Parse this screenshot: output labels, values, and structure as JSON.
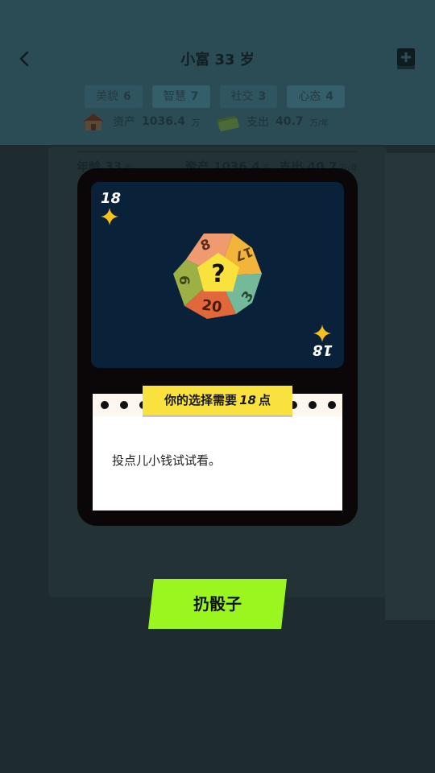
{
  "header": {
    "title": "小富 33 岁"
  },
  "stats": [
    {
      "label": "美貌",
      "value": "6"
    },
    {
      "label": "智慧",
      "value": "7"
    },
    {
      "label": "社交",
      "value": "3"
    },
    {
      "label": "心态",
      "value": "4"
    }
  ],
  "money": {
    "assets_label": "资产",
    "assets_value": "1036.4",
    "assets_unit": "万",
    "expense_label": "支出",
    "expense_value": "40.7",
    "expense_unit": "万/年"
  },
  "summary": {
    "age_label": "年龄",
    "age_value": "33",
    "age_unit": "岁",
    "assets_label": "资产",
    "assets_value": "1036.4",
    "assets_unit": "万",
    "expense_label": "支出",
    "expense_value": "40.7",
    "expense_unit": "万/年"
  },
  "dice_card": {
    "corner_top": "18",
    "corner_bottom": "18",
    "face_center": "?",
    "face_top": "8",
    "face_right_top": "17",
    "face_left": "6",
    "face_right": "3",
    "face_bottom": "20",
    "sparkle_color": "#f4c21a"
  },
  "choice": {
    "prefix": "你的选择需要",
    "points": "18",
    "suffix": "点"
  },
  "note": {
    "text": "投点儿小钱试试看。"
  },
  "roll_button": {
    "label": "扔骰子",
    "color": "#9bf51e"
  }
}
